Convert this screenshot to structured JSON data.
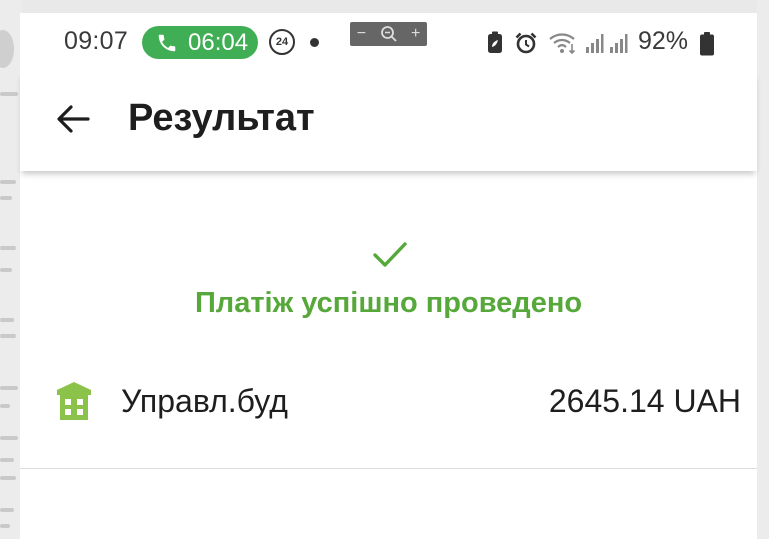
{
  "status_bar": {
    "time": "09:07",
    "call_duration": "06:04",
    "notification_badge": "24",
    "battery_percent": "92%",
    "zoom_controls": {
      "minus": "−",
      "plus": "+"
    },
    "icons": [
      "battery-saver-icon",
      "alarm-icon",
      "wifi-icon",
      "signal-icon",
      "signal-icon",
      "battery-icon"
    ]
  },
  "header": {
    "title": "Результат",
    "back_icon": "arrow-left-icon"
  },
  "result": {
    "status_text": "Платіж успішно проведено",
    "status_icon": "checkmark-icon"
  },
  "payment": {
    "payee_icon": "building-icon",
    "payee": "Управл.буд",
    "amount": "2645.14 UAH"
  },
  "colors": {
    "success": "#56a83a",
    "call_pill": "#3fae54",
    "building_icon": "#8bc34a",
    "text": "#1e1e1e"
  }
}
